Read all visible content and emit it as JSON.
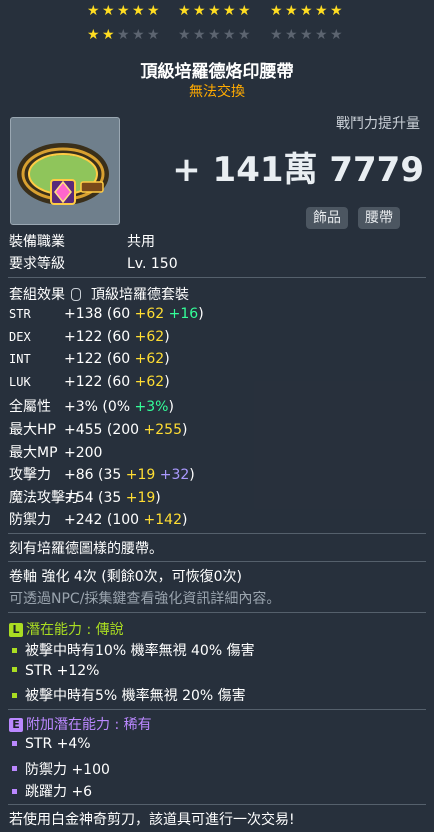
{
  "stars": {
    "total": 30,
    "filled": 17
  },
  "item": {
    "title": "頂級培羅德烙印腰帶",
    "trade_status": "無法交換",
    "combat_power_label": "戰鬥力提升量",
    "combat_power_value": "+ 141萬 7779",
    "tags": [
      "飾品",
      "腰帶"
    ]
  },
  "info": [
    {
      "label": "裝備職業",
      "value": "共用"
    },
    {
      "label": "要求等級",
      "value": "Lv. 150"
    }
  ],
  "set_effect": {
    "label": "套組效果",
    "value": "頂級培羅德套裝"
  },
  "stats": [
    {
      "name": "STR",
      "total": "+138",
      "base": "(60",
      "p1": "+62",
      "p2": "+16",
      "p2_color": "g",
      "close": ")"
    },
    {
      "name": "DEX",
      "total": "+122",
      "base": "(60",
      "p1": "+62",
      "p2": "",
      "p2_color": "",
      "close": ")"
    },
    {
      "name": "INT",
      "total": "+122",
      "base": "(60",
      "p1": "+62",
      "p2": "",
      "p2_color": "",
      "close": ")"
    },
    {
      "name": "LUK",
      "total": "+122",
      "base": "(60",
      "p1": "+62",
      "p2": "",
      "p2_color": "",
      "close": ")"
    },
    {
      "name": "全屬性",
      "total": "+3%",
      "base": "(0%",
      "p1": "",
      "p2": "+3%",
      "p2_color": "g",
      "close": ")"
    },
    {
      "name": "最大HP",
      "total": "+455",
      "base": "(200",
      "p1": "+255",
      "p2": "",
      "p2_color": "",
      "close": ")"
    },
    {
      "name": "最大MP",
      "total": "+200",
      "base": "",
      "p1": "",
      "p2": "",
      "p2_color": "",
      "close": ""
    },
    {
      "name": "攻擊力",
      "total": "+86",
      "base": "(35",
      "p1": "+19",
      "p2": "+32",
      "p2_color": "p",
      "close": ")"
    },
    {
      "name": "魔法攻擊力",
      "total": "+54",
      "base": "(35",
      "p1": "+19",
      "p2": "",
      "p2_color": "",
      "close": ")"
    },
    {
      "name": "防禦力",
      "total": "+242",
      "base": "(100",
      "p1": "+142",
      "p2": "",
      "p2_color": "",
      "close": ")"
    }
  ],
  "description": "刻有培羅德圖樣的腰帶。",
  "scroll_info": "卷軸 強化 4次 (剩餘0次，可恢復0次)",
  "npc_hint": "可透過NPC/採集鍵查看強化資訊詳細內容。",
  "potential": {
    "badge": "L",
    "label": "潛在能力 : 傳說",
    "color": "#aadd22",
    "lines": [
      "被擊中時有10% 機率無視 40% 傷害",
      "STR +12%",
      "被擊中時有5% 機率無視 20% 傷害"
    ]
  },
  "additional_potential": {
    "badge": "E",
    "label": "附加潛在能力 : 稀有",
    "color": "#bb88ff",
    "lines": [
      "STR +4%",
      "防禦力 +100",
      "跳躍力 +6"
    ]
  },
  "footer": "若使用白金神奇剪刀，該道具可進行一次交易!"
}
